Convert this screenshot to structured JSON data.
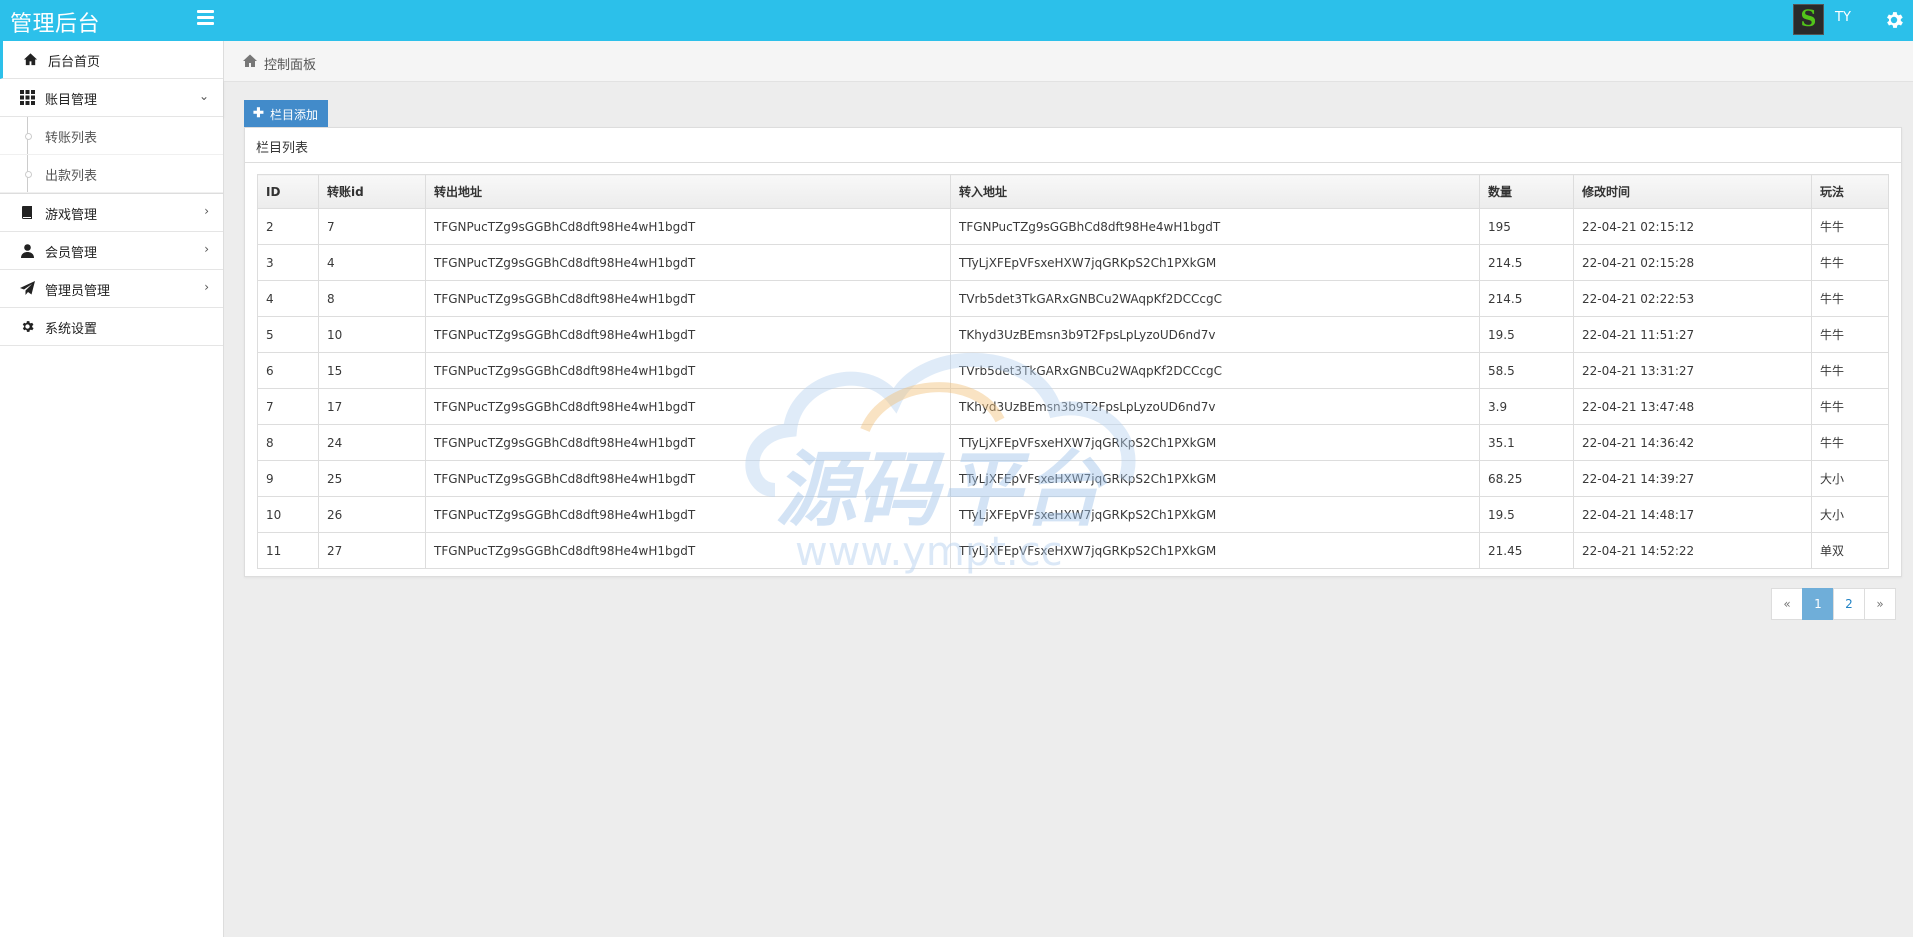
{
  "app": {
    "title": "管理后台"
  },
  "user": {
    "name": "TY",
    "avatar_letter": "S"
  },
  "sidebar": {
    "items": [
      {
        "label": "后台首页",
        "icon": "home-icon"
      },
      {
        "label": "账目管理",
        "icon": "grid-icon",
        "subitems": [
          "转账列表",
          "出款列表"
        ]
      },
      {
        "label": "游戏管理",
        "icon": "book-icon"
      },
      {
        "label": "会员管理",
        "icon": "user-icon"
      },
      {
        "label": "管理员管理",
        "icon": "send-icon"
      },
      {
        "label": "系统设置",
        "icon": "gear-icon"
      }
    ]
  },
  "breadcrumb": {
    "label": "控制面板"
  },
  "toolbar": {
    "add_label": "栏目添加"
  },
  "panel": {
    "title": "栏目列表"
  },
  "table": {
    "headers": [
      "ID",
      "转账id",
      "转出地址",
      "转入地址",
      "数量",
      "修改时间",
      "玩法"
    ],
    "rows": [
      [
        "2",
        "7",
        "TFGNPucTZg9sGGBhCd8dft98He4wH1bgdT",
        "TFGNPucTZg9sGGBhCd8dft98He4wH1bgdT",
        "195",
        "22-04-21 02:15:12",
        "牛牛"
      ],
      [
        "3",
        "4",
        "TFGNPucTZg9sGGBhCd8dft98He4wH1bgdT",
        "TTyLjXFEpVFsxeHXW7jqGRKpS2Ch1PXkGM",
        "214.5",
        "22-04-21 02:15:28",
        "牛牛"
      ],
      [
        "4",
        "8",
        "TFGNPucTZg9sGGBhCd8dft98He4wH1bgdT",
        "TVrb5det3TkGARxGNBCu2WAqpKf2DCCcgC",
        "214.5",
        "22-04-21 02:22:53",
        "牛牛"
      ],
      [
        "5",
        "10",
        "TFGNPucTZg9sGGBhCd8dft98He4wH1bgdT",
        "TKhyd3UzBEmsn3b9T2FpsLpLyzoUD6nd7v",
        "19.5",
        "22-04-21 11:51:27",
        "牛牛"
      ],
      [
        "6",
        "15",
        "TFGNPucTZg9sGGBhCd8dft98He4wH1bgdT",
        "TVrb5det3TkGARxGNBCu2WAqpKf2DCCcgC",
        "58.5",
        "22-04-21 13:31:27",
        "牛牛"
      ],
      [
        "7",
        "17",
        "TFGNPucTZg9sGGBhCd8dft98He4wH1bgdT",
        "TKhyd3UzBEmsn3b9T2FpsLpLyzoUD6nd7v",
        "3.9",
        "22-04-21 13:47:48",
        "牛牛"
      ],
      [
        "8",
        "24",
        "TFGNPucTZg9sGGBhCd8dft98He4wH1bgdT",
        "TTyLjXFEpVFsxeHXW7jqGRKpS2Ch1PXkGM",
        "35.1",
        "22-04-21 14:36:42",
        "牛牛"
      ],
      [
        "9",
        "25",
        "TFGNPucTZg9sGGBhCd8dft98He4wH1bgdT",
        "TTyLjXFEpVFsxeHXW7jqGRKpS2Ch1PXkGM",
        "68.25",
        "22-04-21 14:39:27",
        "大小"
      ],
      [
        "10",
        "26",
        "TFGNPucTZg9sGGBhCd8dft98He4wH1bgdT",
        "TTyLjXFEpVFsxeHXW7jqGRKpS2Ch1PXkGM",
        "19.5",
        "22-04-21 14:48:17",
        "大小"
      ],
      [
        "11",
        "27",
        "TFGNPucTZg9sGGBhCd8dft98He4wH1bgdT",
        "TTyLjXFEpVFsxeHXW7jqGRKpS2Ch1PXkGM",
        "21.45",
        "22-04-21 14:52:22",
        "单双"
      ]
    ]
  },
  "pagination": {
    "prev": "«",
    "pages": [
      "1",
      "2"
    ],
    "active": "1",
    "next": "»"
  },
  "watermark": {
    "text": "源码平台",
    "url": "www.ympt.cc"
  },
  "colors": {
    "navbar": "#2cc0ea",
    "primary": "#428bca",
    "page_active": "#6faed9"
  }
}
